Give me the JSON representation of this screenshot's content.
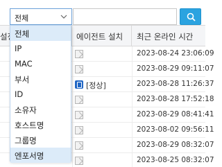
{
  "filter": {
    "selected": "전체",
    "options": [
      "전체",
      "IP",
      "MAC",
      "부서",
      "ID",
      "소유자",
      "호스트명",
      "그룹명",
      "엔포서명"
    ]
  },
  "search": {
    "button_icon": "search-icon",
    "value": ""
  },
  "columns": {
    "left_partial": "설정",
    "agent": "에이전트 설치",
    "last_online": "최근 온라인 시간"
  },
  "rows": [
    {
      "agent": "",
      "date": "2023-08-24 23:06:09"
    },
    {
      "agent": "",
      "date": "2023-08-29 09:11:07"
    },
    {
      "agent": "[정상]",
      "date": "2023-08-28 11:26:37"
    },
    {
      "agent": "",
      "date": "2023-08-28 17:52:18"
    },
    {
      "agent": "",
      "date": "2023-08-29 08:41:41"
    },
    {
      "agent": "",
      "date": "2023-08-02 09:56:11"
    },
    {
      "agent": "",
      "date": "2023-08-29 08:32:07"
    },
    {
      "agent": "",
      "date": "2023-08-25 08:32:07"
    }
  ],
  "colors": {
    "accent": "#2ba3e0",
    "selected_option": "#dcebf9"
  }
}
